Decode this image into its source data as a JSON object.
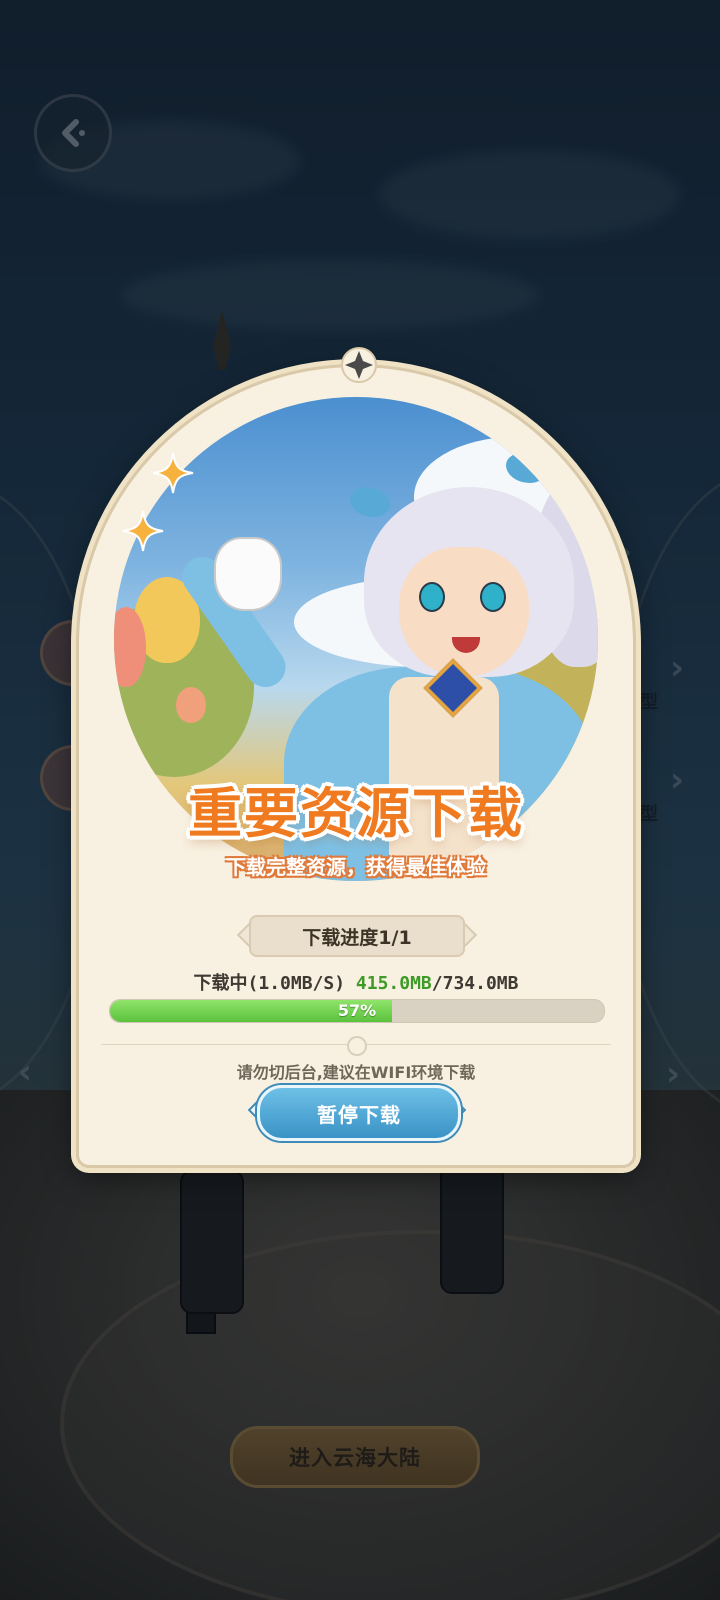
{
  "background": {
    "side_labels": [
      "型",
      "型"
    ],
    "enter_button_label": "进入云海大陆"
  },
  "dialog": {
    "title": "重要资源下载",
    "subtitle": "下载完整资源，获得最佳体验",
    "progress_tag": "下载进度1/1",
    "status": {
      "prefix": "下载中(1.0MB/S) ",
      "current": "415.0MB",
      "total": "/734.0MB"
    },
    "progress_percent_label": "57%",
    "progress_value": 0.57,
    "hint": "请勿切后台,建议在WIFI环境下载",
    "pause_button_label": "暂停下载"
  },
  "colors": {
    "title": "#f07a1f",
    "progress_fill": "#5bc23c",
    "current_size": "#3f9a28",
    "pause_button": "#3a93c6"
  },
  "icons": [
    "back-arrow-icon",
    "sparkle-icon",
    "gem-icon",
    "gear-icon",
    "chevron-right-icon",
    "chevron-left-icon"
  ]
}
